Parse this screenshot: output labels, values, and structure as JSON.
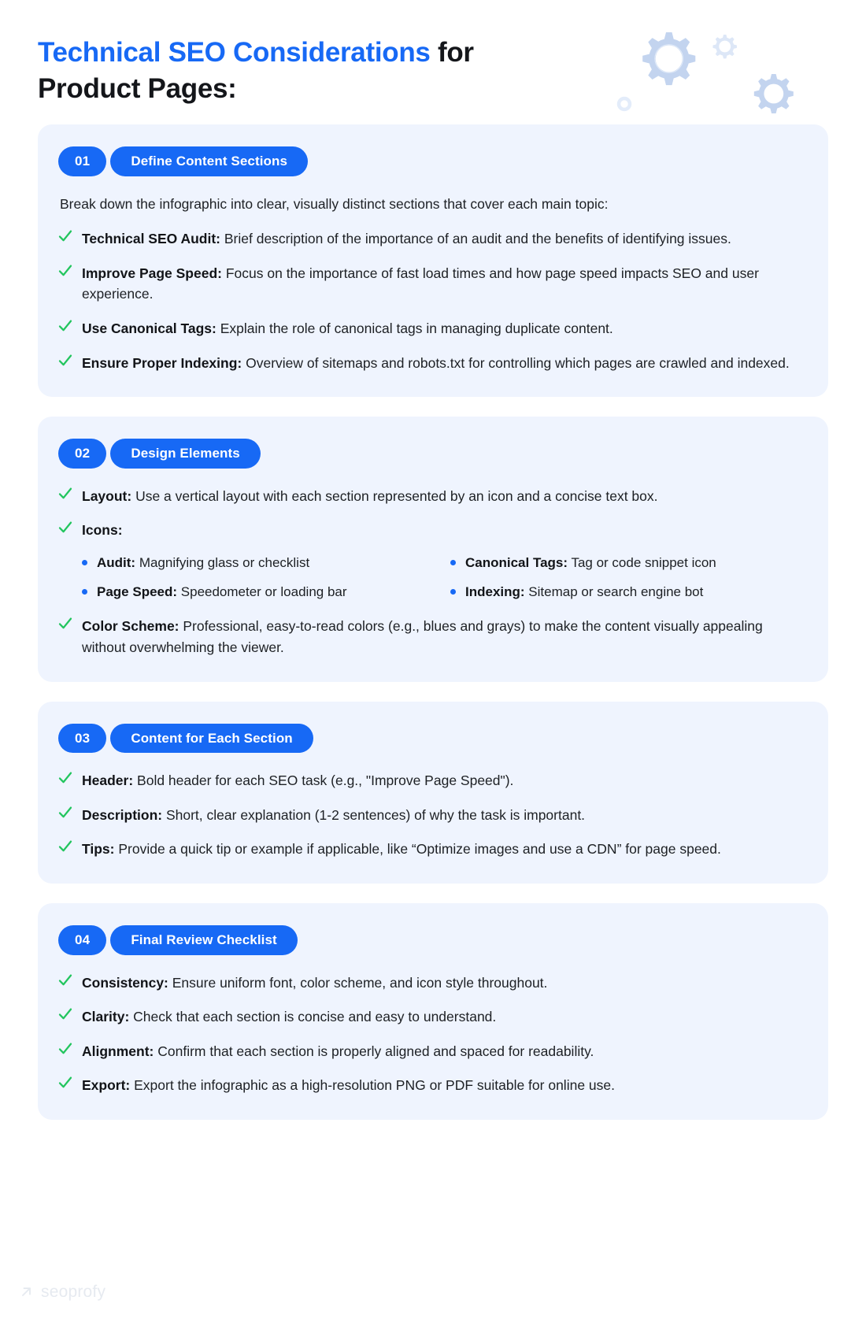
{
  "header": {
    "title_accent": "Technical SEO Considerations",
    "title_rest": " for",
    "title_line2": "Product Pages:",
    "accent_color": "#1769f5",
    "gear_icon": "gears-icon"
  },
  "colors": {
    "accent": "#1769f5",
    "card_bg": "#eff4fe",
    "check_green": "#22c55e",
    "text": "#1d2024",
    "gear_fill": "#c3d4ef"
  },
  "sections": [
    {
      "number": "01",
      "label": "Define Content Sections",
      "intro": "Break down the infographic into clear, visually distinct sections that cover each main topic:",
      "items": [
        {
          "lead": "Technical SEO Audit:",
          "text": " Brief description of the importance of an audit and the benefits of identifying issues."
        },
        {
          "lead": "Improve Page Speed:",
          "text": " Focus on the importance of fast load times and how page speed impacts SEO and user experience."
        },
        {
          "lead": "Use Canonical Tags:",
          "text": " Explain the role of canonical tags in managing duplicate content."
        },
        {
          "lead": "Ensure Proper Indexing:",
          "text": " Overview of sitemaps and robots.txt for controlling which pages are crawled and indexed."
        }
      ]
    },
    {
      "number": "02",
      "label": "Design Elements",
      "items": [
        {
          "lead": "Layout:",
          "text": " Use a vertical layout with each section represented by an icon and a concise text box."
        },
        {
          "lead": "Icons:",
          "text": ""
        },
        {
          "lead": "Color Scheme:",
          "text": " Professional, easy-to-read colors (e.g., blues and grays) to make the content visually appealing without overwhelming the viewer."
        }
      ],
      "sub_items": [
        {
          "lead": "Audit:",
          "text": " Magnifying glass or checklist"
        },
        {
          "lead": "Canonical Tags:",
          "text": " Tag or code snippet icon"
        },
        {
          "lead": "Page Speed:",
          "text": " Speedometer or loading bar"
        },
        {
          "lead": "Indexing:",
          "text": " Sitemap or search engine bot"
        }
      ]
    },
    {
      "number": "03",
      "label": "Content for Each Section",
      "items": [
        {
          "lead": "Header:",
          "text": " Bold header for each SEO task (e.g., \"Improve Page Speed\")."
        },
        {
          "lead": "Description:",
          "text": " Short, clear explanation (1-2 sentences) of why the task is important."
        },
        {
          "lead": "Tips:",
          "text": " Provide a quick tip or example if applicable, like “Optimize images and use a CDN” for page speed."
        }
      ]
    },
    {
      "number": "04",
      "label": "Final Review Checklist",
      "items": [
        {
          "lead": "Consistency:",
          "text": " Ensure uniform font, color scheme, and icon style throughout."
        },
        {
          "lead": "Clarity:",
          "text": " Check that each section is concise and easy to understand."
        },
        {
          "lead": "Alignment:",
          "text": " Confirm that each section is properly aligned and spaced for readability."
        },
        {
          "lead": "Export:",
          "text": " Export the infographic as a high-resolution PNG or PDF suitable for online use."
        }
      ]
    }
  ],
  "footer": {
    "brand": "seoprofy",
    "mark_icon": "arrow-up-right-icon"
  }
}
